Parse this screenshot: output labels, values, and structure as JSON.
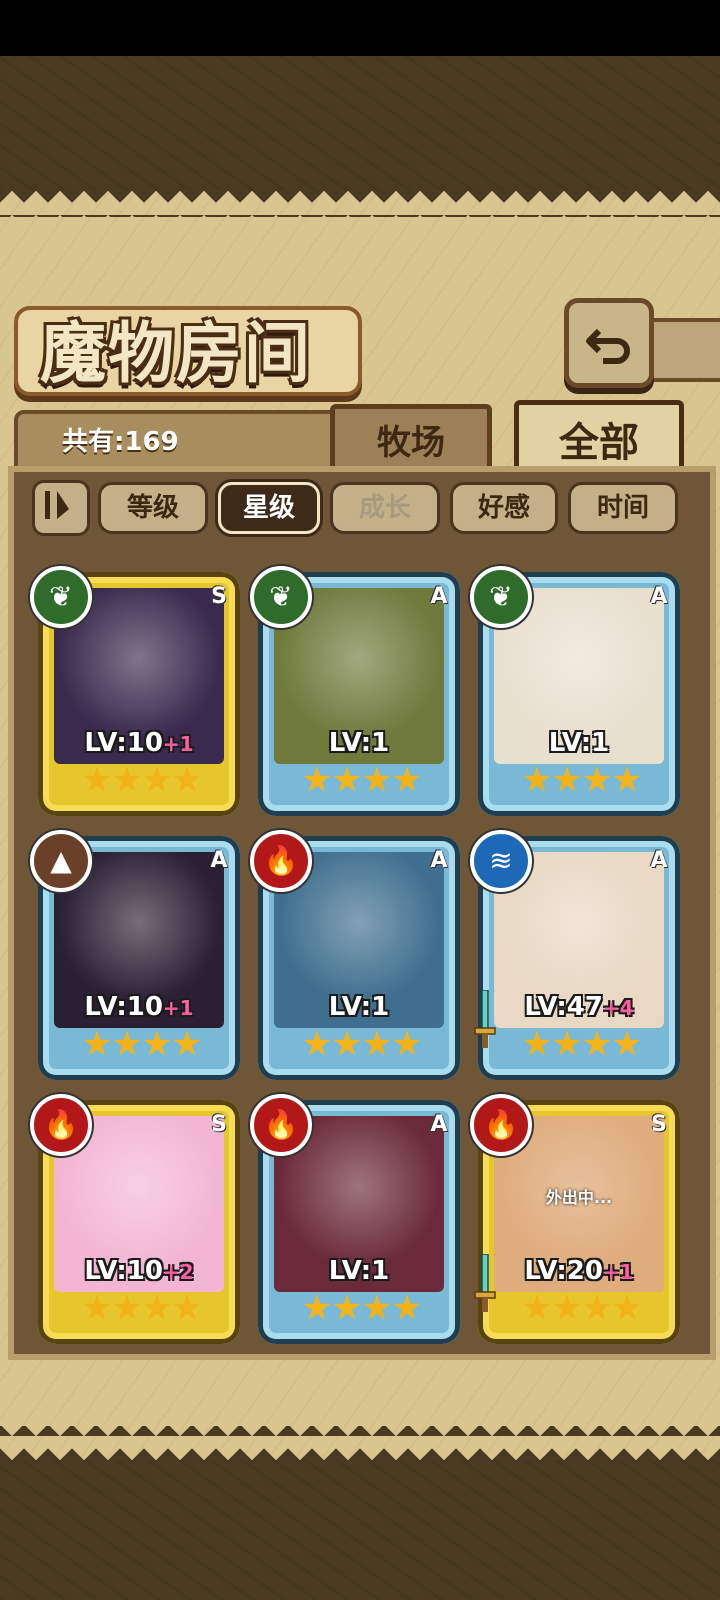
{
  "screen": {
    "title": "魔物房间",
    "count_label": "共有:169",
    "tabs": [
      {
        "label": "牧场",
        "active": false
      },
      {
        "label": "全部",
        "active": true
      }
    ],
    "sort": [
      {
        "label": "等级",
        "state": "normal"
      },
      {
        "label": "星级",
        "state": "active"
      },
      {
        "label": "成长",
        "state": "dim"
      },
      {
        "label": "好感",
        "state": "normal"
      },
      {
        "label": "时间",
        "state": "normal"
      }
    ],
    "cards": [
      {
        "rank": "S",
        "element": "leaf-icon",
        "element_color": "#2f6b2a",
        "level": "LV:10",
        "bonus": "+1",
        "stars": 4,
        "portrait_color": "#3a2a4e"
      },
      {
        "rank": "A",
        "element": "leaf-icon",
        "element_color": "#2f6b2a",
        "level": "LV:1",
        "bonus": "",
        "stars": 4,
        "portrait_color": "#6f7a3c"
      },
      {
        "rank": "A",
        "element": "leaf-icon",
        "element_color": "#2f6b2a",
        "level": "LV:1",
        "bonus": "",
        "stars": 4,
        "portrait_color": "#e9dfcf"
      },
      {
        "rank": "A",
        "element": "mountain-icon",
        "element_color": "#6a4028",
        "level": "LV:10",
        "bonus": "+1",
        "stars": 4,
        "portrait_color": "#2a1f33"
      },
      {
        "rank": "A",
        "element": "fire-icon",
        "element_color": "#b21818",
        "level": "LV:1",
        "bonus": "",
        "stars": 4,
        "portrait_color": "#3f6e8e"
      },
      {
        "rank": "A",
        "element": "water-icon",
        "element_color": "#1d69b8",
        "level": "LV:47",
        "bonus": "+4",
        "stars": 4,
        "portrait_color": "#e8d8c4"
      },
      {
        "rank": "S",
        "element": "fire-icon",
        "element_color": "#b21818",
        "level": "LV:10",
        "bonus": "+2",
        "stars": 4,
        "portrait_color": "#f3b6d2"
      },
      {
        "rank": "A",
        "element": "fire-icon",
        "element_color": "#b21818",
        "level": "LV:1",
        "bonus": "",
        "stars": 4,
        "portrait_color": "#6a2a3a"
      },
      {
        "rank": "S",
        "element": "fire-icon",
        "element_color": "#b21818",
        "level": "LV:20",
        "bonus": "+1",
        "stars": 4,
        "portrait_color": "#d87f4a",
        "status": "外出中..."
      }
    ]
  }
}
